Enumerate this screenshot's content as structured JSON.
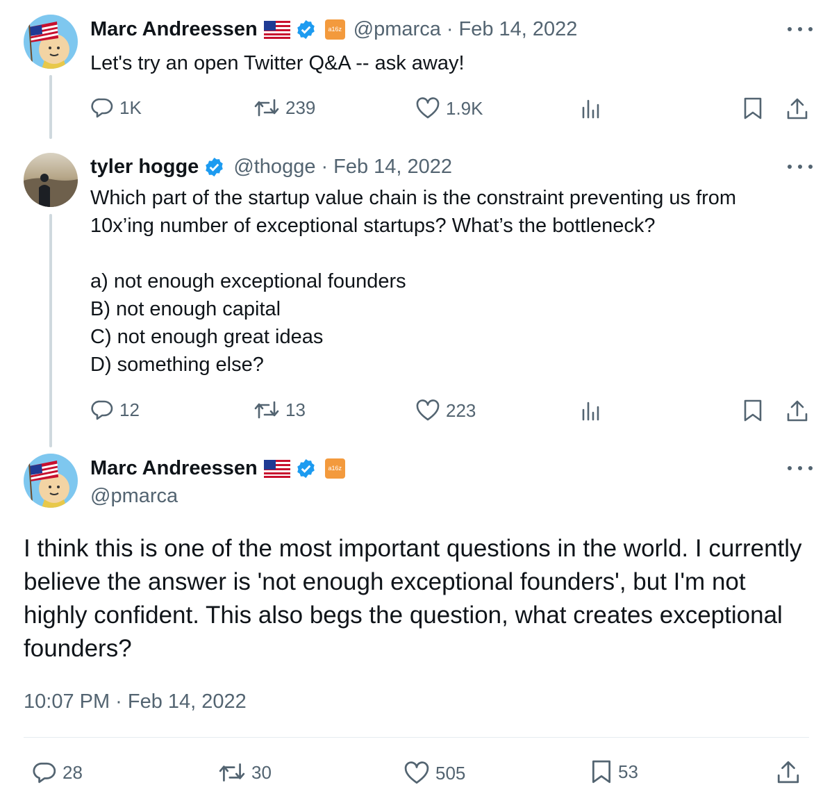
{
  "tweet1": {
    "name": "Marc Andreessen",
    "handle": "@pmarca",
    "separator": "·",
    "date": "Feb 14, 2022",
    "badge_text": "a16z",
    "text": "Let's try an open Twitter Q&A -- ask away!",
    "replies": "1K",
    "retweets": "239",
    "likes": "1.9K"
  },
  "tweet2": {
    "name": "tyler hogge",
    "handle": "@thogge",
    "separator": "·",
    "date": "Feb 14, 2022",
    "text": "Which part of the startup value chain is the constraint preventing us from 10x’ing number of exceptional startups? What’s the bottleneck?\n\na) not enough exceptional founders\nB) not enough capital\nC) not enough great ideas\nD) something else?",
    "replies": "12",
    "retweets": "13",
    "likes": "223"
  },
  "main_tweet": {
    "name": "Marc Andreessen",
    "handle": "@pmarca",
    "badge_text": "a16z",
    "text": "I think this is one of the most important questions in the world. I currently believe the answer is 'not enough exceptional founders', but I'm not highly confident. This also begs the question, what creates exceptional founders?",
    "timestamp": "10:07 PM · Feb 14, 2022",
    "replies": "28",
    "retweets": "30",
    "likes": "505",
    "bookmarks": "53"
  },
  "colors": {
    "text": "#0f1419",
    "secondary": "#536471",
    "verified": "#1d9bf0",
    "thread_line": "#cfd9de",
    "a16z_badge": "#f39a3d"
  }
}
